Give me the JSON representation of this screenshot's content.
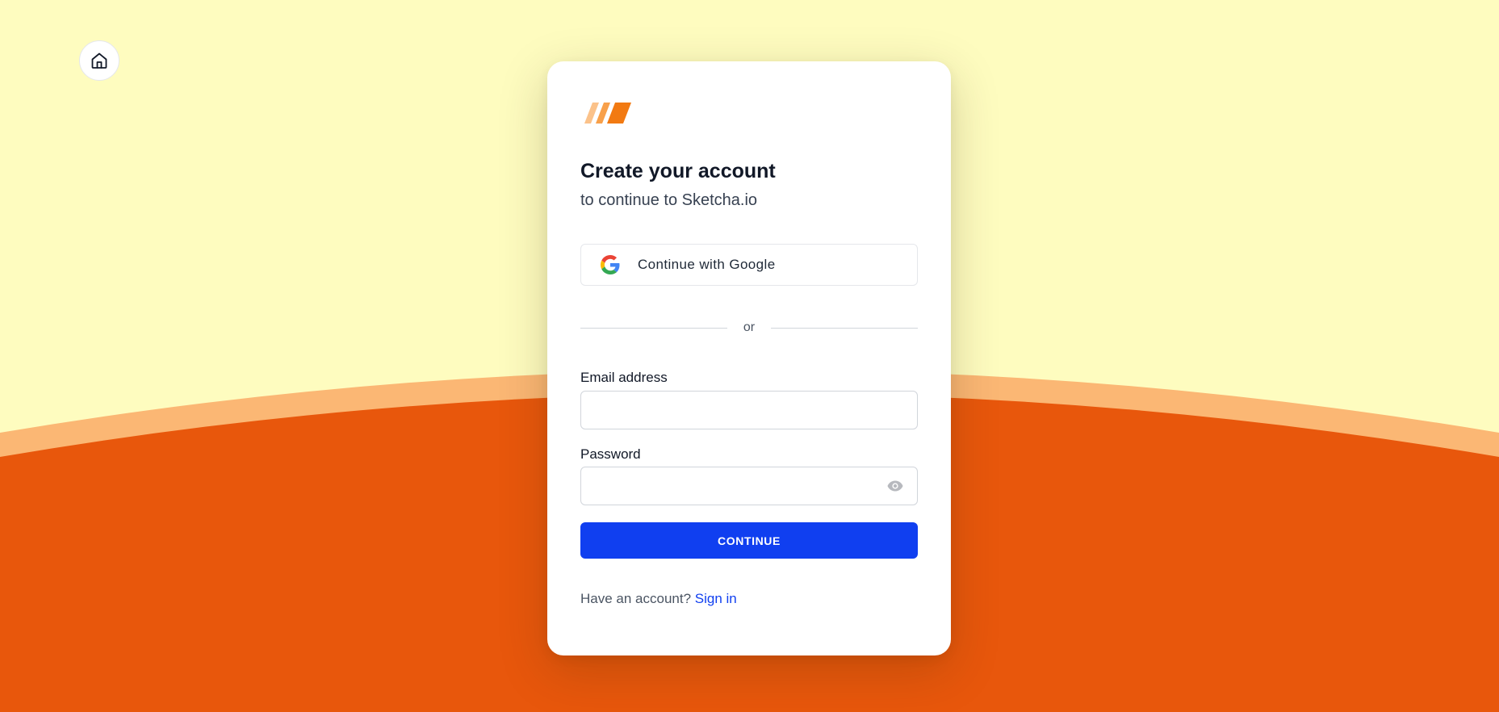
{
  "colors": {
    "background_top": "#fefcbf",
    "wave_light": "#fbb774",
    "wave_dark": "#e8570c",
    "primary": "#103ff0",
    "logo_light": "#fbc28a",
    "logo_mid": "#f8a04a",
    "logo_dark": "#f27a12"
  },
  "nav": {
    "home_icon": "home-icon"
  },
  "card": {
    "title": "Create your account",
    "subtitle": "to continue to Sketcha.io",
    "google_button_label": "Continue with Google",
    "divider_text": "or",
    "email_label": "Email address",
    "email_value": "",
    "password_label": "Password",
    "password_value": "",
    "password_toggle_icon": "eye-icon",
    "continue_label": "CONTINUE",
    "footer_prompt": "Have an account?",
    "footer_link": "Sign in"
  }
}
